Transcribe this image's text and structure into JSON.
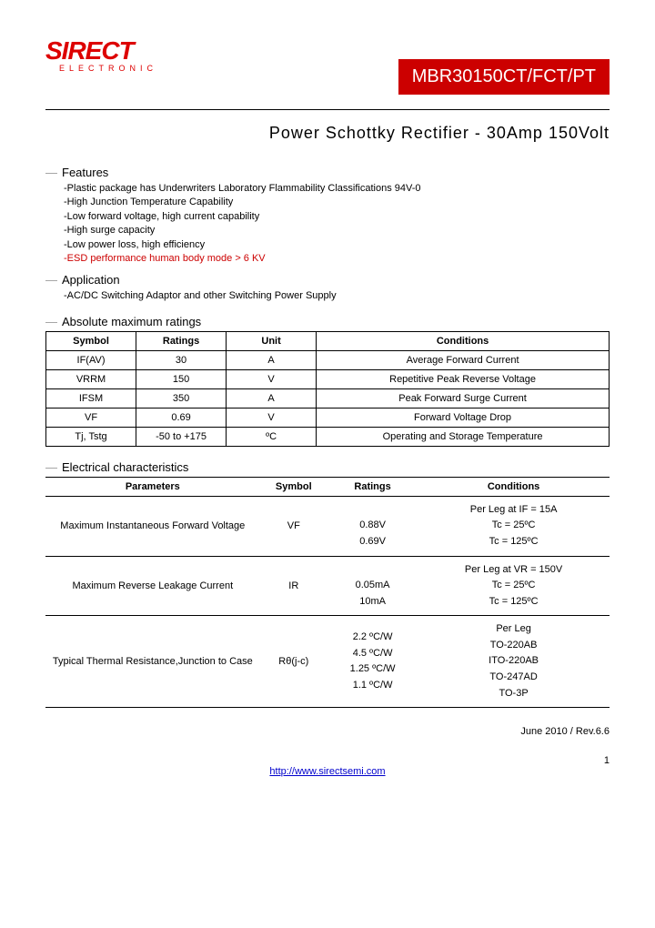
{
  "logo": {
    "main": "SIRECT",
    "sub": "ELECTRONIC"
  },
  "partNumber": "MBR30150CT/FCT/PT",
  "title": "Power Schottky Rectifier - 30Amp 150Volt",
  "features": {
    "heading": "Features",
    "items": [
      "-Plastic package has Underwriters Laboratory Flammability Classifications 94V-0",
      "-High Junction Temperature Capability",
      "-Low forward voltage, high current capability",
      "-High surge capacity",
      "-Low power loss, high efficiency"
    ],
    "esd": "-ESD performance human body mode > 6 KV"
  },
  "application": {
    "heading": "Application",
    "text": "-AC/DC Switching Adaptor and other Switching Power Supply"
  },
  "absMax": {
    "heading": "Absolute maximum ratings",
    "headers": [
      "Symbol",
      "Ratings",
      "Unit",
      "Conditions"
    ],
    "rows": [
      {
        "symbol": "IF(AV)",
        "ratings": "30",
        "unit": "A",
        "cond": "Average Forward Current"
      },
      {
        "symbol": "VRRM",
        "ratings": "150",
        "unit": "V",
        "cond": "Repetitive Peak Reverse Voltage"
      },
      {
        "symbol": "IFSM",
        "ratings": "350",
        "unit": "A",
        "cond": "Peak Forward Surge Current"
      },
      {
        "symbol": "VF",
        "ratings": "0.69",
        "unit": "V",
        "cond": "Forward Voltage Drop"
      },
      {
        "symbol": "Tj, Tstg",
        "ratings": "-50 to +175",
        "unit": "ºC",
        "cond": "Operating and Storage Temperature"
      }
    ]
  },
  "elec": {
    "heading": "Electrical characteristics",
    "headers": [
      "Parameters",
      "Symbol",
      "Ratings",
      "Conditions"
    ],
    "rows": [
      {
        "param": "Maximum Instantaneous Forward Voltage",
        "symbol": "VF",
        "ratings": "\n0.88V\n0.69V",
        "cond": "Per Leg at IF = 15A\nTc = 25ºC\nTc = 125ºC"
      },
      {
        "param": "Maximum Reverse Leakage Current",
        "symbol": "IR",
        "ratings": "\n0.05mA\n10mA",
        "cond": "Per Leg at VR = 150V\nTc = 25ºC\nTc = 125ºC"
      },
      {
        "param": "Typical Thermal Resistance,Junction to Case",
        "symbol": "Rθ(j-c)",
        "ratings": "2.2 ºC/W\n4.5 ºC/W\n1.25 ºC/W\n1.1 ºC/W",
        "cond": "Per Leg\nTO-220AB\nITO-220AB\nTO-247AD\nTO-3P"
      }
    ]
  },
  "footer": {
    "rev": "June 2010 / Rev.6.6",
    "page": "1",
    "url": "http://www.sirectsemi.com"
  }
}
